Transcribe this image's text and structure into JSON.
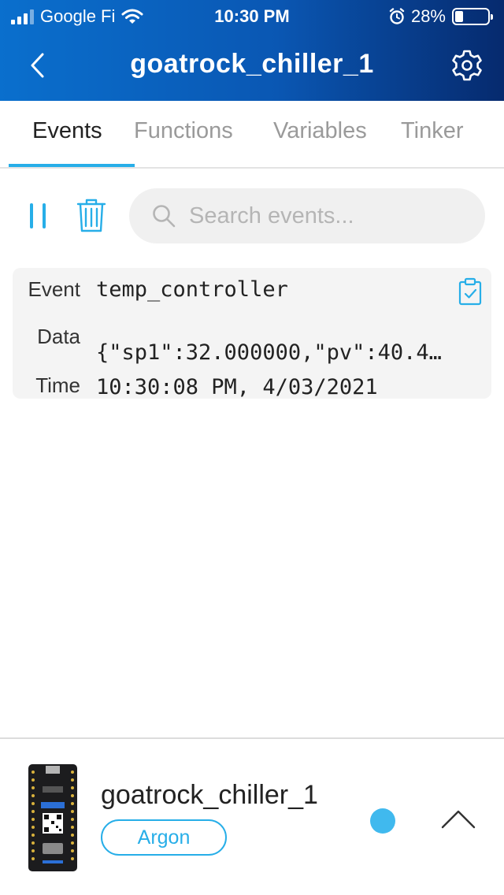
{
  "status_bar": {
    "carrier": "Google Fi",
    "time": "10:30 PM",
    "battery": "28%"
  },
  "nav": {
    "title": "goatrock_chiller_1",
    "back_icon": "chevron-left-icon",
    "settings_icon": "gear-icon"
  },
  "tabs": [
    {
      "label": "Events",
      "active": true
    },
    {
      "label": "Functions",
      "active": false
    },
    {
      "label": "Variables",
      "active": false
    },
    {
      "label": "Tinker",
      "active": false
    }
  ],
  "toolbar": {
    "pause_icon": "pause-icon",
    "trash_icon": "trash-icon",
    "search_placeholder": "Search events..."
  },
  "event": {
    "event_label": "Event",
    "event_value": "temp_controller",
    "data_label": "Data",
    "data_value": "{\"sp1\":32.000000,\"pv\":40.4…",
    "time_label": "Time",
    "time_value": "10:30:08 PM, 4/03/2021"
  },
  "device": {
    "name": "goatrock_chiller_1",
    "type": "Argon",
    "status_color": "#40b9ee"
  },
  "colors": {
    "accent": "#27aee8",
    "header_start": "#0a6fcd",
    "header_end": "#062a6e"
  }
}
